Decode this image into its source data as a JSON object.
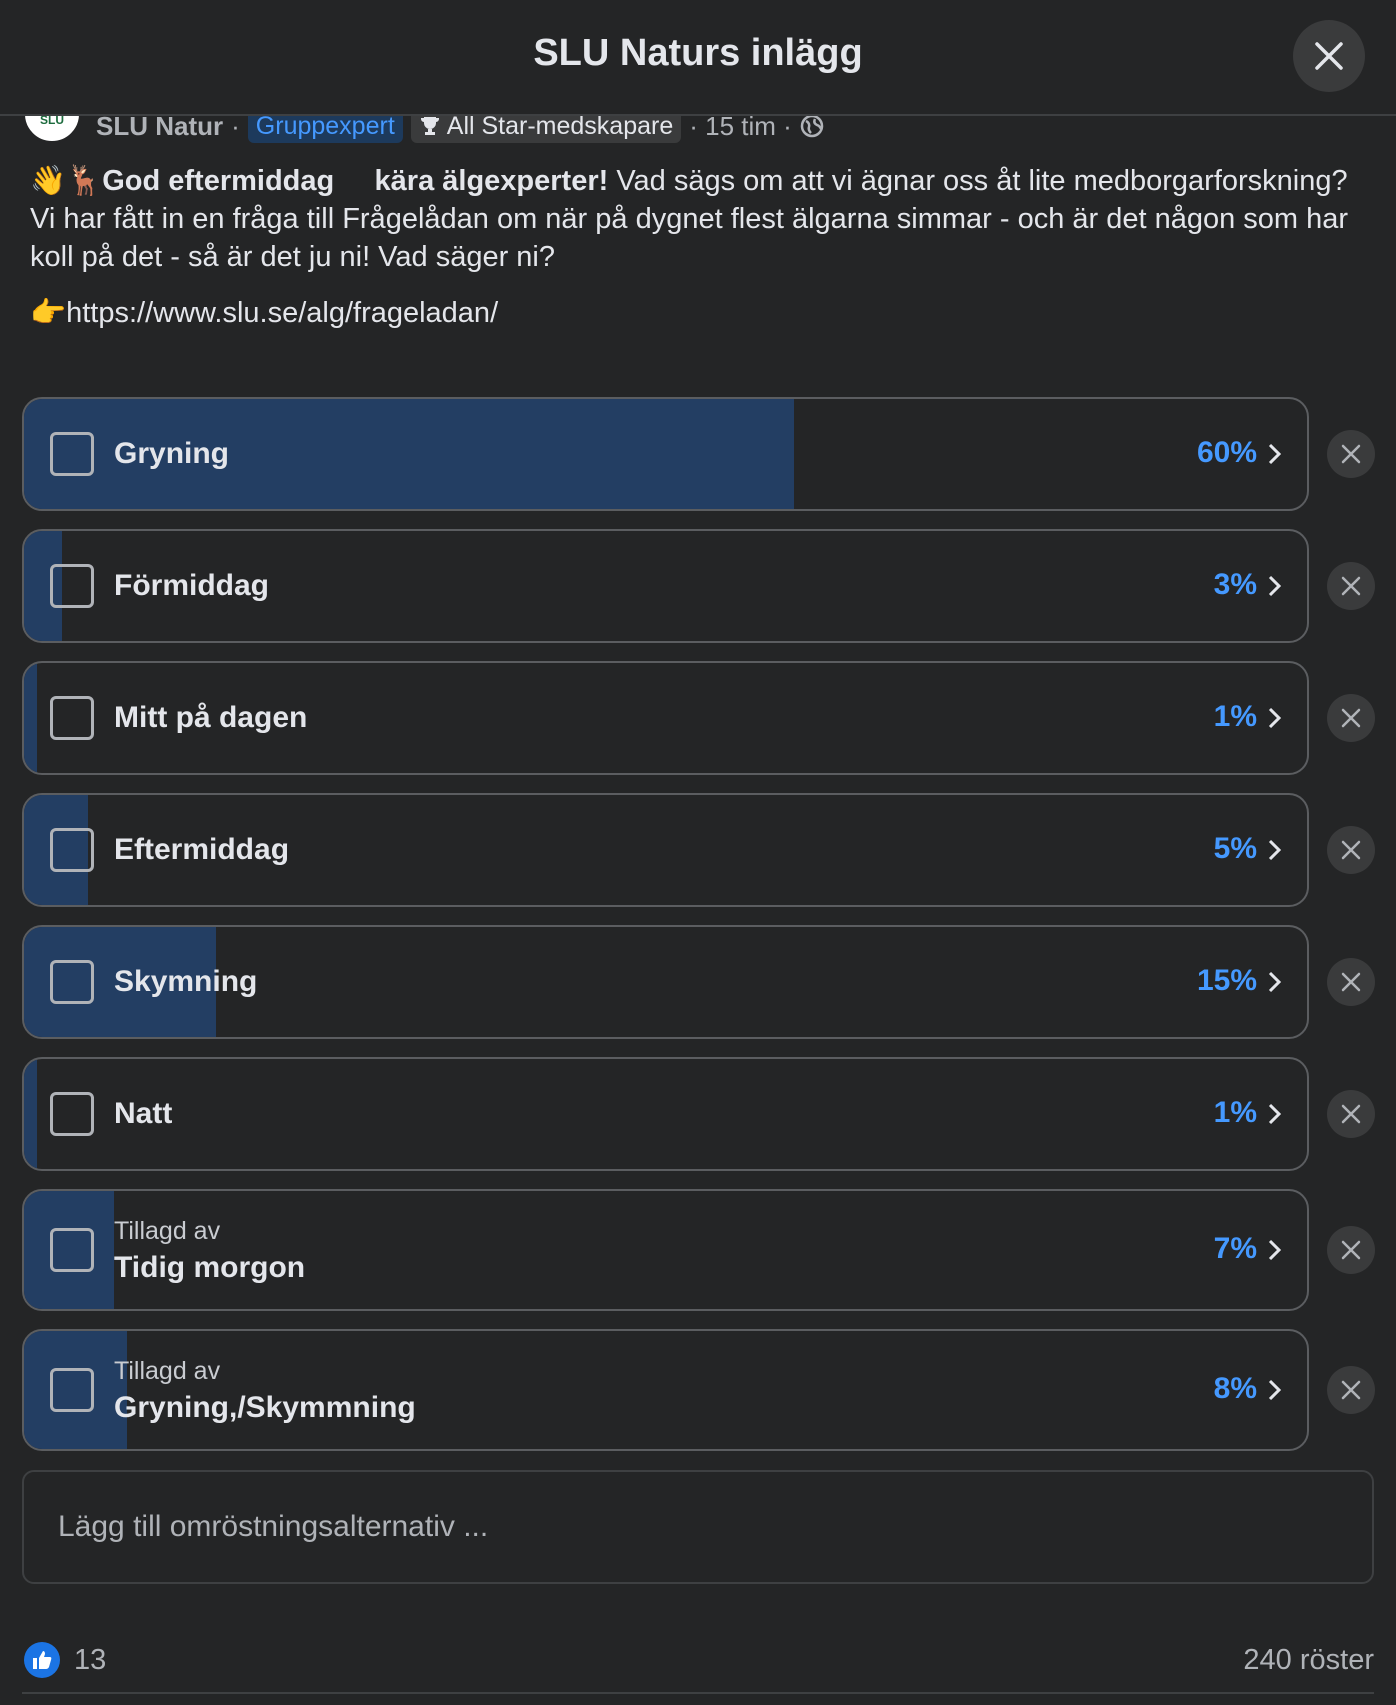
{
  "header": {
    "title": "SLU Naturs inlägg"
  },
  "post": {
    "author": "SLU Natur",
    "avatar_text": "SLU",
    "badge_expert": "Gruppexpert",
    "badge_star": "All Star-medskapare",
    "time": "· 15 tim ·",
    "greeting_bold": "God eftermiddag",
    "greeting_bold2": "kära älgexperter!",
    "body": "Vad sägs om att vi ägnar oss åt lite medborgarforskning? Vi har fått in en fråga till Frågelådan om när på dygnet flest älgarna simmar - och är det någon som har koll på det - så är det ju ni! Vad säger ni?",
    "link": "https://www.slu.se/alg/frageladan/",
    "emoji_wave": "👋",
    "emoji_moose": "🦌",
    "emoji_point": "👉"
  },
  "poll": {
    "accent_color": "#4599ff",
    "fill_color": "#233e63",
    "options": [
      {
        "label": "Gryning",
        "percent_text": "60%",
        "fill": 0.6
      },
      {
        "label": "Förmiddag",
        "percent_text": "3%",
        "fill": 0.03
      },
      {
        "label": "Mitt på dagen",
        "percent_text": "1%",
        "fill": 0.01
      },
      {
        "label": "Eftermiddag",
        "percent_text": "5%",
        "fill": 0.05
      },
      {
        "label": "Skymning",
        "percent_text": "15%",
        "fill": 0.15
      },
      {
        "label": "Natt",
        "percent_text": "1%",
        "fill": 0.01
      },
      {
        "label": "Tidig morgon",
        "added_by": "Tillagd av",
        "percent_text": "7%",
        "fill": 0.07
      },
      {
        "label": "Gryning,/Skymmning",
        "added_by": "Tillagd av",
        "percent_text": "8%",
        "fill": 0.08
      }
    ],
    "add_placeholder": "Lägg till omröstningsalternativ ..."
  },
  "footer": {
    "like_count": "13",
    "votes": "240 röster"
  }
}
